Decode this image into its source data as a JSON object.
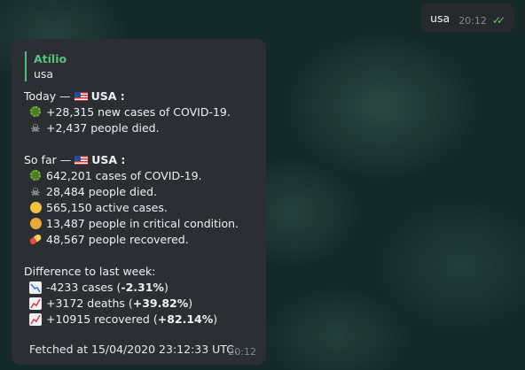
{
  "outgoing": {
    "text": "usa",
    "time": "20:12"
  },
  "message": {
    "reply_name": "Atílio",
    "reply_text": "usa",
    "today_label": "Today —",
    "country": "USA :",
    "today_cases": "+28,315 new cases of COVID-19.",
    "today_died": "+2,437 people died.",
    "sofar_label": "So far —",
    "sofar_cases": "642,201 cases of COVID-19.",
    "sofar_died": "28,484 people died.",
    "sofar_active": "565,150 active cases.",
    "sofar_critical": "13,487 people in critical condition.",
    "sofar_recovered": "48,567 people recovered.",
    "diff_label": "Difference to last week:",
    "diff_cases_main": "-4233 cases (",
    "diff_cases_pct": "-2.31%",
    "diff_deaths_main": "+3172 deaths (",
    "diff_deaths_pct": "+39.82%",
    "diff_recovered_main": "+10915 recovered (",
    "diff_recovered_pct": "+82.14%",
    "close_paren": ")",
    "fetched": "Fetched at 15/04/2020 23:12:33 UTC.",
    "time": "20:12"
  },
  "icons": [
    "double-check-icon",
    "virus-icon",
    "skull-icon",
    "usa-flag-icon",
    "sleepy-face-icon",
    "sick-face-icon",
    "pill-icon",
    "chart-decreasing-icon",
    "chart-increasing-icon"
  ]
}
